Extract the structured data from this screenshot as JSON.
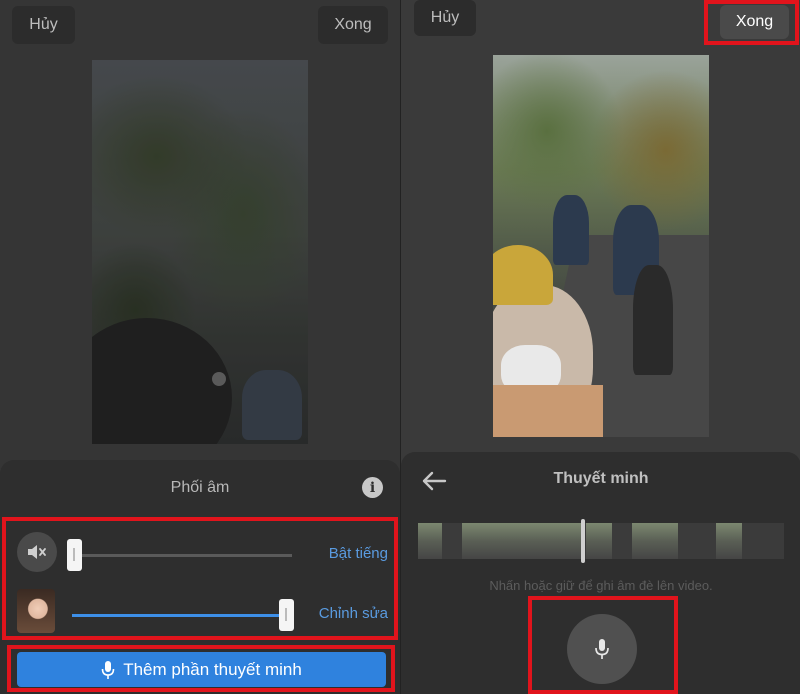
{
  "left_screen": {
    "cancel_label": "Hủy",
    "done_label": "Xong",
    "sheet_title": "Phối âm",
    "original_audio": {
      "link_label": "Bật tiếng",
      "volume_percent": 0
    },
    "narration_audio": {
      "link_label": "Chỉnh sửa",
      "volume_percent": 100
    },
    "add_narration_label": "Thêm phần thuyết minh"
  },
  "right_screen": {
    "cancel_label": "Hủy",
    "done_label": "Xong",
    "sheet_title": "Thuyết minh",
    "hint_text": "Nhấn hoặc giữ để ghi âm đè lên video."
  },
  "colors": {
    "highlight": "#e1141c",
    "accent_blue": "#2f82de",
    "link_blue": "#5a9be0"
  },
  "icons": [
    "info-icon",
    "mute-icon",
    "mic-icon",
    "back-arrow-icon"
  ]
}
